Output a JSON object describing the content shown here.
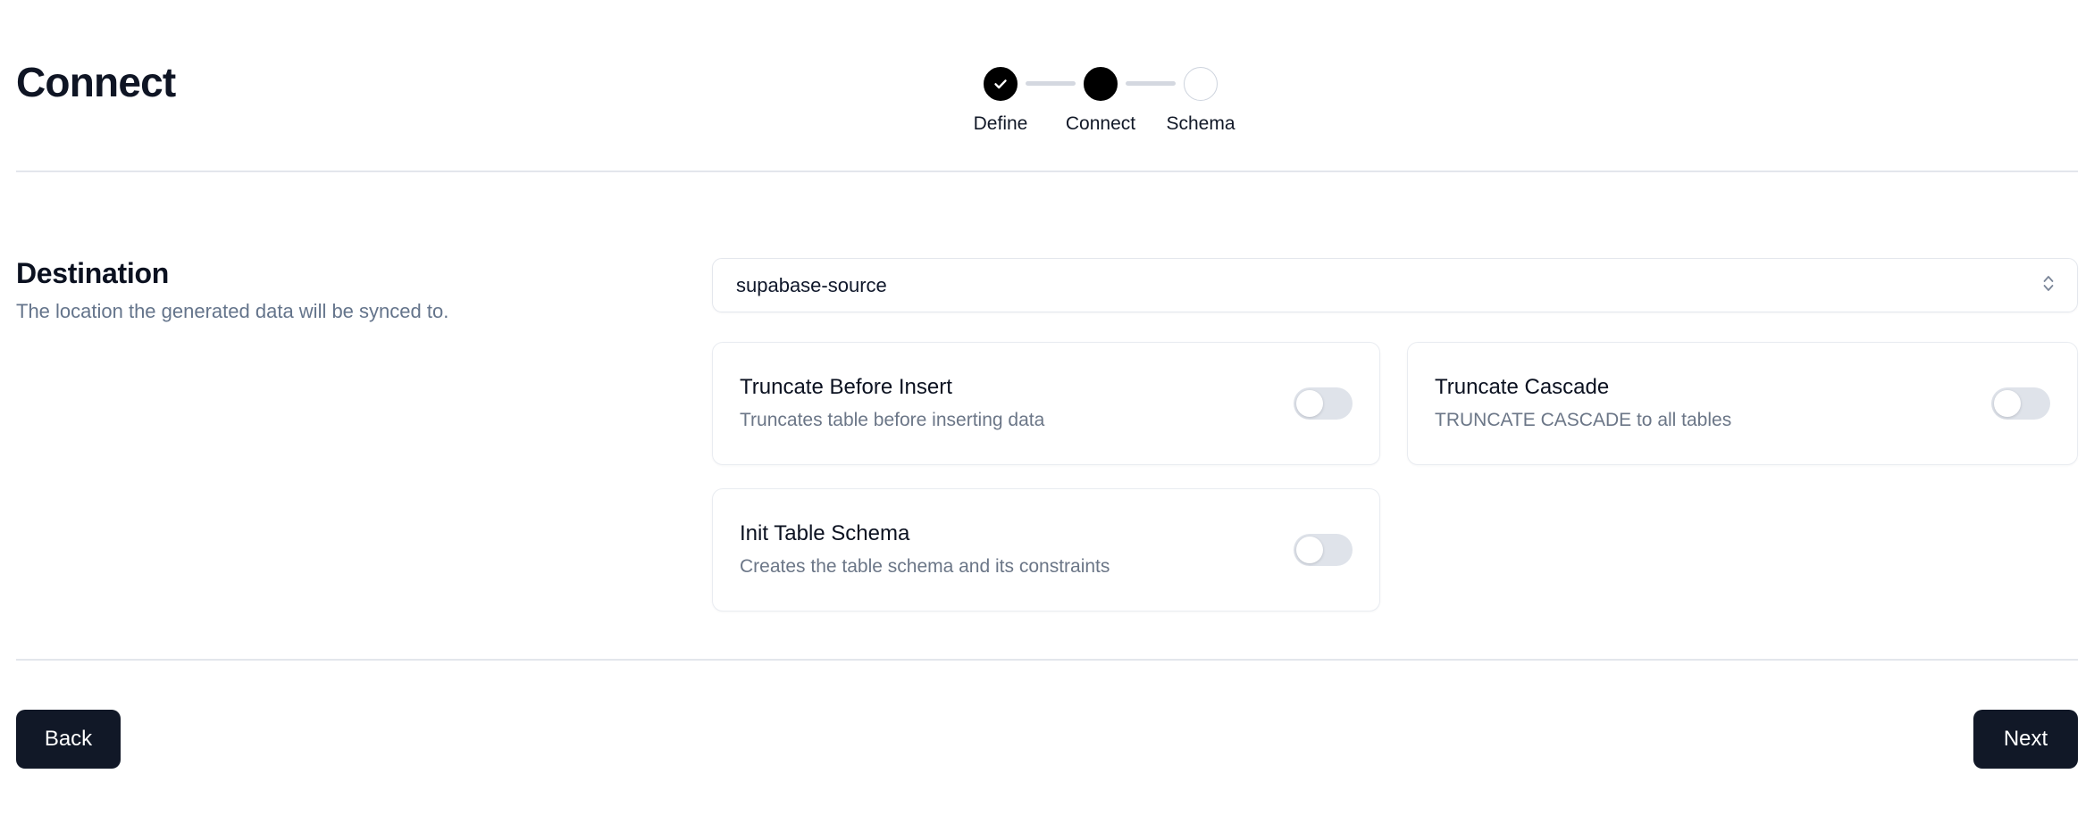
{
  "header": {
    "title": "Connect",
    "stepper": {
      "steps": [
        {
          "label": "Define",
          "state": "done"
        },
        {
          "label": "Connect",
          "state": "current"
        },
        {
          "label": "Schema",
          "state": "upcoming"
        }
      ]
    }
  },
  "destination": {
    "title": "Destination",
    "subtitle": "The location the generated data will be synced to.",
    "select": {
      "value": "supabase-source",
      "icon": "chevron-up-down-icon"
    },
    "options": [
      {
        "title": "Truncate Before Insert",
        "description": "Truncates table before inserting data",
        "toggle_state": "off"
      },
      {
        "title": "Truncate Cascade",
        "description": "TRUNCATE CASCADE to all tables",
        "toggle_state": "off"
      },
      {
        "title": "Init Table Schema",
        "description": "Creates the table schema and its constraints",
        "toggle_state": "off"
      }
    ]
  },
  "footer": {
    "back_label": "Back",
    "next_label": "Next"
  },
  "colors": {
    "accent": "#111827",
    "step_active": "#000000",
    "border": "#e4e7ed",
    "muted_text": "#64748b",
    "toggle_off_track": "#dfe3ea"
  }
}
